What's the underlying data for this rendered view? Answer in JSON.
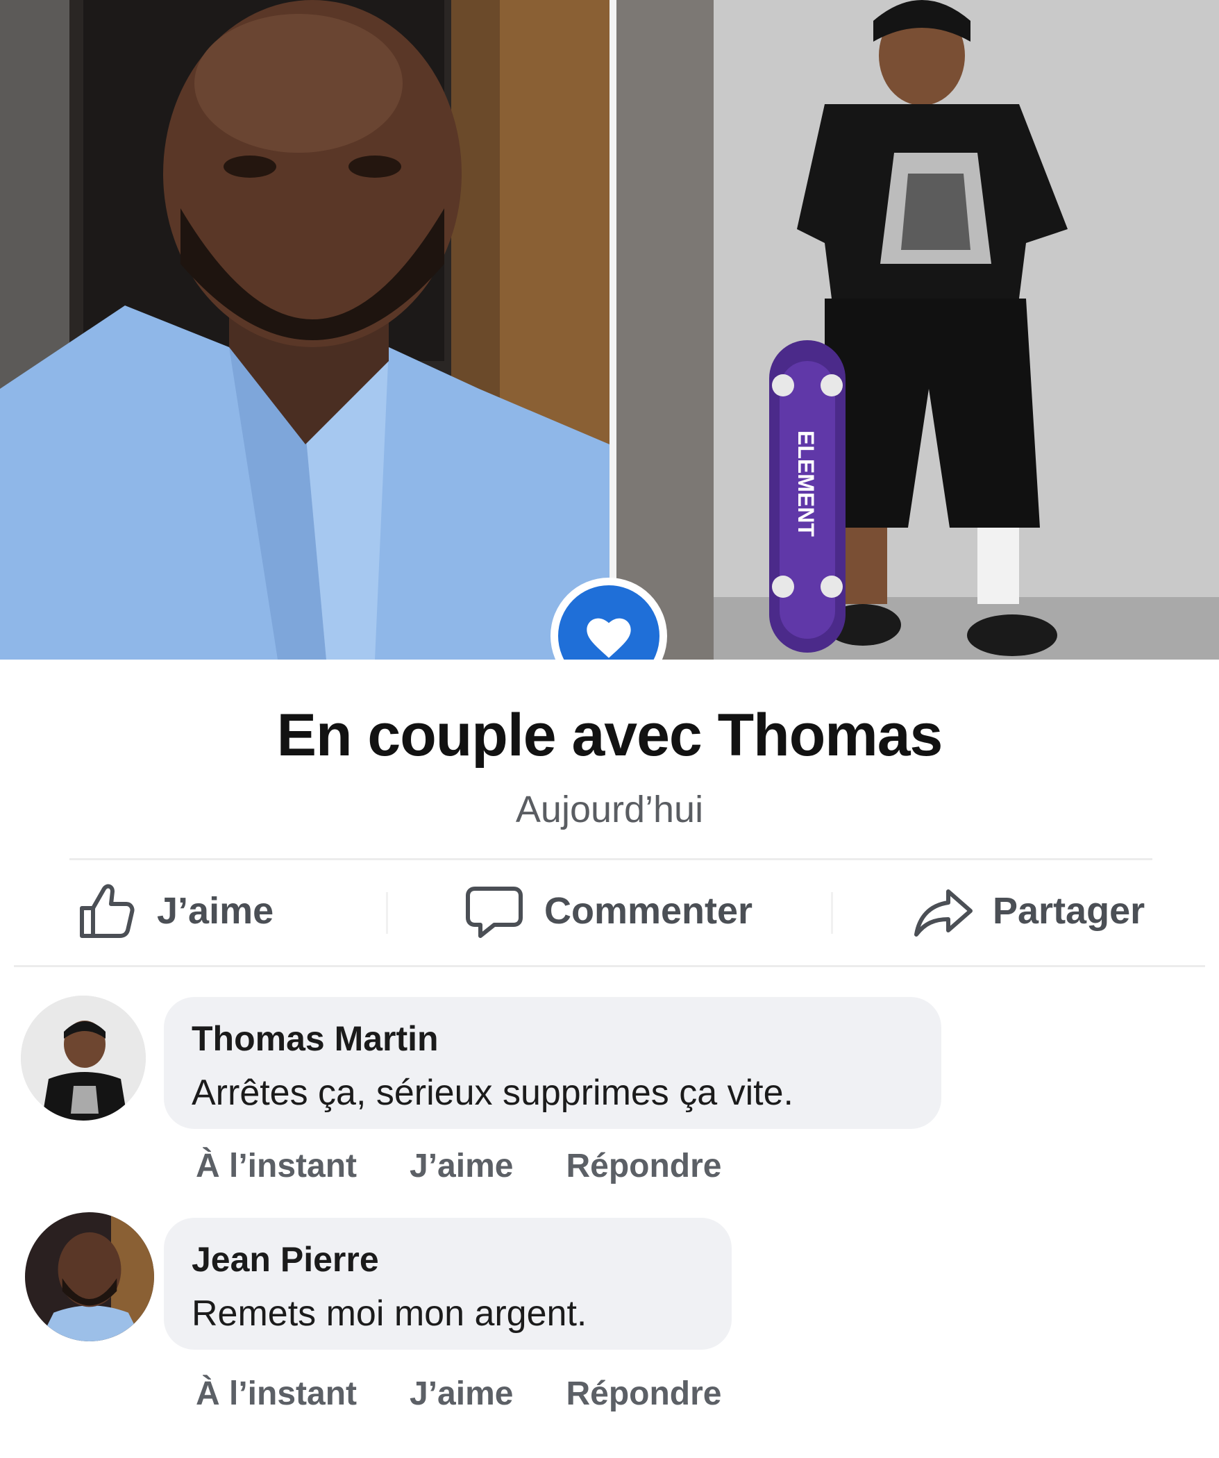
{
  "post": {
    "status_title": "En couple avec Thomas",
    "status_date": "Aujourd’hui",
    "badge_icon": "heart-icon"
  },
  "photos": {
    "right_skateboard_text": "ELEMENT"
  },
  "actions": {
    "like_label": "J’aime",
    "comment_label": "Commenter",
    "share_label": "Partager"
  },
  "comments": [
    {
      "author": "Thomas Martin",
      "text": "Arrêtes ça, sérieux supprimes ça vite.",
      "time": "À l’instant",
      "like": "J’aime",
      "reply": "Répondre"
    },
    {
      "author": "Jean Pierre",
      "text": "Remets moi mon argent.",
      "time": "À l’instant",
      "like": "J’aime",
      "reply": "Répondre"
    }
  ],
  "colors": {
    "accent": "#1f6fd8",
    "text": "#121212",
    "muted": "#5a5d62",
    "bubble": "#f0f1f4"
  }
}
